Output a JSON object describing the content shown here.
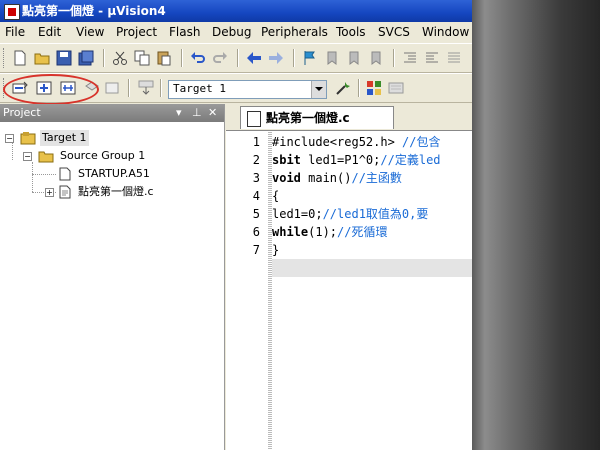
{
  "window": {
    "title": "點亮第一個燈 - µVision4"
  },
  "menu": [
    "File",
    "Edit",
    "View",
    "Project",
    "Flash",
    "Debug",
    "Peripherals",
    "Tools",
    "SVCS",
    "Window"
  ],
  "toolbar": {
    "target_value": "Target 1"
  },
  "project_panel": {
    "title": "Project",
    "tree": {
      "target": "Target 1",
      "group": "Source Group 1",
      "files": [
        "STARTUP.A51",
        "點亮第一個燈.c"
      ]
    }
  },
  "editor": {
    "tab_title": "點亮第一個燈.c",
    "line_numbers": [
      "1",
      "2",
      "3",
      "4",
      "5",
      "6",
      "7"
    ],
    "lines": [
      {
        "kw": "",
        "code": "#include<reg52.h> ",
        "comment": "//包含"
      },
      {
        "kw": "sbit",
        "code": " led1=P1^0;",
        "comment": "//定義led"
      },
      {
        "kw": "void",
        "code": " main()",
        "comment": "//主函數"
      },
      {
        "kw": "",
        "code": "{",
        "comment": ""
      },
      {
        "kw": "",
        "code": "led1=0;",
        "comment": "//led1取值為0,要"
      },
      {
        "kw": "while",
        "code": "(1);",
        "comment": "//死循環"
      },
      {
        "kw": "",
        "code": "}",
        "comment": ""
      }
    ]
  },
  "colors": {
    "title_bar": "#1546c0",
    "comment": "#1a6bd6",
    "annotation_circle": "#d8332b"
  }
}
